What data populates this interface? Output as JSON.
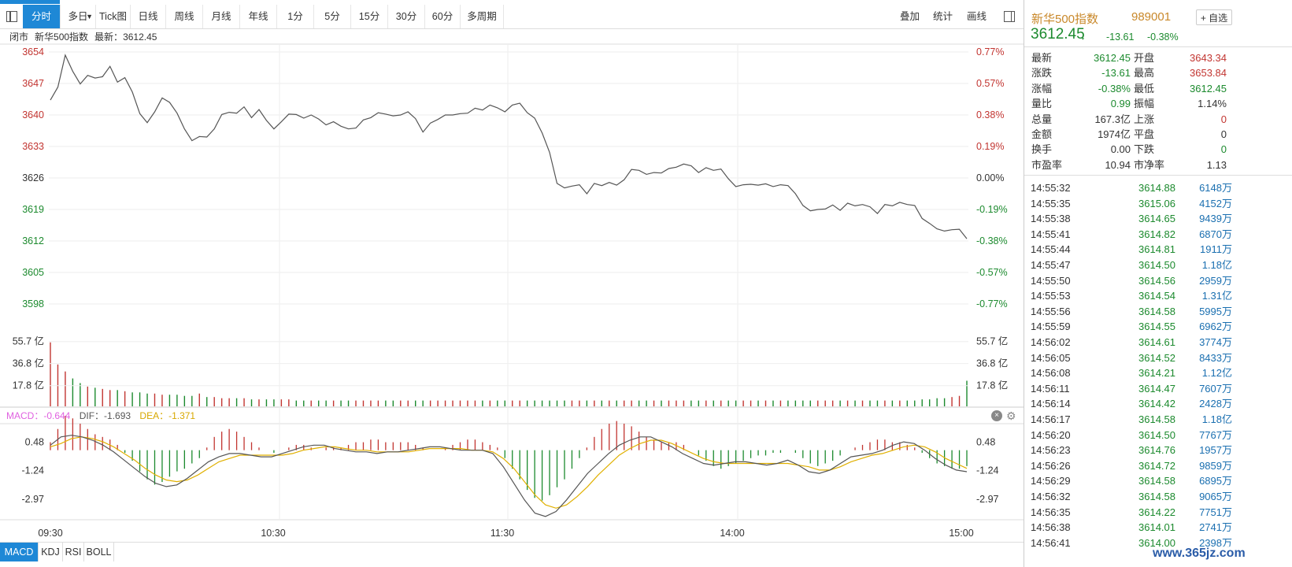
{
  "colors": {
    "accent": "#1e88d6",
    "up": "#c23531",
    "down": "#1c8a2e",
    "line": "#555555",
    "dif": "#555555",
    "dea": "#e0b000",
    "macd": "#e060e0",
    "title": "#c9882a",
    "volume_text": "#1a6fb0"
  },
  "toolbar": {
    "tabs": [
      "分时",
      "多日",
      "Tick图",
      "日线",
      "周线",
      "月线",
      "年线",
      "1分",
      "5分",
      "15分",
      "30分",
      "60分",
      "多周期"
    ],
    "active": "分时",
    "right": [
      "叠加",
      "统计",
      "画线"
    ],
    "multiday_caret": "▼"
  },
  "info": {
    "status": "闭市",
    "name": "新华500指数",
    "latest_label": "最新：",
    "latest_value": "3612.45"
  },
  "chart_data": {
    "type": "line",
    "price_axis": {
      "left_ticks": [
        "3654",
        "3647",
        "3640",
        "3633",
        "3626",
        "3619",
        "3612",
        "3605",
        "3598"
      ],
      "right_ticks": [
        "0.77%",
        "0.57%",
        "0.38%",
        "0.19%",
        "0.00%",
        "-0.19%",
        "-0.38%",
        "-0.57%",
        "-0.77%"
      ],
      "ylim": [
        3598,
        3654
      ],
      "base": 3626.06
    },
    "volume_axis": {
      "left_ticks": [
        "55.7 亿",
        "36.8 亿",
        "17.8 亿"
      ],
      "right_ticks": [
        "55.7 亿",
        "36.8 亿",
        "17.8 亿"
      ],
      "ylim": [
        0,
        65
      ]
    },
    "macd_axis": {
      "left_ticks": [
        "0.48",
        "-1.24",
        "-2.97"
      ],
      "right_ticks": [
        "0.48",
        "-1.24",
        "-2.97"
      ],
      "ylim": [
        -4.2,
        1.6
      ]
    },
    "x_ticks": [
      "09:30",
      "10:30",
      "11:30",
      "14:00",
      "15:00"
    ],
    "price_series": [
      3643.3,
      3646.2,
      3653.3,
      3649.7,
      3646.9,
      3648.8,
      3648.2,
      3648.5,
      3650.8,
      3647.3,
      3648.3,
      3645.1,
      3640.3,
      3638.3,
      3640.7,
      3643.8,
      3642.8,
      3640.4,
      3636.9,
      3634.3,
      3635.2,
      3635.1,
      3636.9,
      3640.1,
      3640.6,
      3640.4,
      3641.8,
      3639.4,
      3641.2,
      3638.8,
      3636.9,
      3638.5,
      3640.2,
      3640.1,
      3639.3,
      3640.0,
      3639.1,
      3637.8,
      3638.5,
      3637.5,
      3636.9,
      3637.1,
      3638.9,
      3639.4,
      3640.5,
      3640.2,
      3639.8,
      3640.0,
      3640.7,
      3639.2,
      3636.2,
      3638.2,
      3639.0,
      3640.0,
      3640.0,
      3640.3,
      3640.4,
      3641.5,
      3641.1,
      3642.2,
      3641.6,
      3640.7,
      3642.2,
      3642.6,
      3640.5,
      3639.3,
      3636.0,
      3631.7,
      3624.8,
      3623.8,
      3624.2,
      3624.5,
      3622.5,
      3624.8,
      3624.3,
      3625.0,
      3624.4,
      3625.6,
      3627.9,
      3627.7,
      3626.8,
      3627.2,
      3627.1,
      3628.1,
      3628.4,
      3629.1,
      3628.7,
      3627.2,
      3628.3,
      3627.7,
      3628.0,
      3625.8,
      3624.1,
      3624.5,
      3624.6,
      3624.4,
      3624.7,
      3624.1,
      3624.5,
      3624.3,
      3622.5,
      3619.9,
      3618.7,
      3619.0,
      3619.1,
      3620.0,
      3618.8,
      3620.4,
      3619.8,
      3620.1,
      3619.6,
      3618.1,
      3620.1,
      3619.8,
      3620.6,
      3620.1,
      3619.9,
      3617.0,
      3615.9,
      3614.7,
      3614.2,
      3614.5,
      3614.6,
      3612.5
    ],
    "volume_series": [
      55,
      36,
      30,
      24,
      20,
      17,
      16,
      15,
      14,
      14,
      13,
      12,
      12,
      11,
      11,
      10,
      10,
      10,
      9,
      9,
      11,
      8,
      8,
      7,
      7,
      7,
      7,
      6,
      6,
      6,
      6,
      6,
      6,
      5,
      5,
      5,
      5,
      5,
      5,
      5,
      5,
      5,
      5,
      5,
      5,
      5,
      5,
      5,
      5,
      5,
      5,
      5,
      5,
      5,
      5,
      5,
      5,
      5,
      5,
      5,
      5,
      5,
      5,
      5,
      5,
      5,
      5,
      5,
      5,
      5,
      5,
      5,
      5,
      5,
      5,
      5,
      5,
      5,
      5,
      5,
      5,
      5,
      5,
      5,
      5,
      5,
      5,
      5,
      5,
      5,
      5,
      5,
      5,
      5,
      5,
      5,
      5,
      5,
      5,
      5,
      5,
      5,
      5,
      5,
      5,
      5,
      5,
      5,
      5,
      5,
      5,
      5,
      5,
      5,
      5,
      5,
      5,
      6,
      6,
      7,
      7,
      8,
      9,
      22
    ],
    "macd_series": [
      0.3,
      0.8,
      1.3,
      1.2,
      1.0,
      0.8,
      0.6,
      0.5,
      0.4,
      0.2,
      -0.1,
      -0.4,
      -0.8,
      -1.1,
      -1.3,
      -1.2,
      -1.0,
      -0.8,
      -0.7,
      -0.5,
      -0.3,
      0.1,
      0.5,
      0.7,
      0.8,
      0.7,
      0.5,
      0.3,
      0.1,
      0.0,
      -0.1,
      0.0,
      0.1,
      0.2,
      0.2,
      0.1,
      0.0,
      0.1,
      0.1,
      0.1,
      0.2,
      0.3,
      0.3,
      0.4,
      0.4,
      0.3,
      0.3,
      0.3,
      0.3,
      0.2,
      0.1,
      0.0,
      0.0,
      0.1,
      0.2,
      0.3,
      0.4,
      0.4,
      0.3,
      0.2,
      0.1,
      -0.3,
      -0.7,
      -1.1,
      -1.5,
      -1.8,
      -1.9,
      -1.7,
      -1.4,
      -1.1,
      -0.7,
      -0.3,
      0.1,
      0.5,
      0.8,
      1.0,
      1.1,
      1.0,
      0.9,
      0.7,
      0.5,
      0.4,
      0.3,
      0.3,
      0.3,
      0.2,
      0.0,
      -0.2,
      -0.4,
      -0.6,
      -0.7,
      -0.6,
      -0.5,
      -0.4,
      -0.3,
      -0.2,
      -0.2,
      -0.1,
      -0.1,
      0.0,
      -0.1,
      -0.3,
      -0.5,
      -0.6,
      -0.5,
      -0.4,
      -0.2,
      0.0,
      0.1,
      0.2,
      0.3,
      0.4,
      0.4,
      0.3,
      0.3,
      0.2,
      0.1,
      -0.1,
      -0.3,
      -0.5,
      -0.6,
      -0.7,
      -0.7,
      -0.6
    ],
    "dif_series": [
      0.3,
      0.8,
      0.9,
      0.8,
      0.6,
      0.3,
      -0.1,
      -0.6,
      -1.1,
      -1.6,
      -2.0,
      -2.2,
      -2.1,
      -1.7,
      -1.2,
      -0.7,
      -0.4,
      -0.2,
      -0.2,
      -0.3,
      -0.4,
      -0.4,
      -0.2,
      0.0,
      0.2,
      0.3,
      0.3,
      0.1,
      0.0,
      -0.1,
      -0.1,
      -0.2,
      -0.1,
      -0.1,
      0.0,
      0.1,
      0.2,
      0.2,
      0.1,
      0.0,
      0.0,
      0.0,
      -0.2,
      -1.0,
      -2.0,
      -3.0,
      -3.8,
      -4.0,
      -3.7,
      -3.0,
      -2.2,
      -1.4,
      -0.8,
      -0.2,
      0.3,
      0.6,
      0.8,
      0.8,
      0.5,
      0.2,
      -0.2,
      -0.5,
      -0.8,
      -0.9,
      -0.8,
      -0.7,
      -0.7,
      -0.8,
      -0.9,
      -0.8,
      -0.6,
      -0.9,
      -1.3,
      -1.4,
      -1.2,
      -0.8,
      -0.4,
      -0.3,
      -0.2,
      0.0,
      0.3,
      0.5,
      0.4,
      0.0,
      -0.5,
      -0.9,
      -1.2,
      -1.3
    ],
    "dea_series": [
      0.2,
      0.4,
      0.7,
      0.8,
      0.7,
      0.5,
      0.2,
      -0.2,
      -0.6,
      -1.1,
      -1.5,
      -1.8,
      -1.9,
      -1.8,
      -1.5,
      -1.1,
      -0.7,
      -0.5,
      -0.3,
      -0.3,
      -0.3,
      -0.3,
      -0.3,
      -0.2,
      0.0,
      0.1,
      0.2,
      0.2,
      0.1,
      0.0,
      0.0,
      -0.1,
      -0.1,
      -0.1,
      -0.1,
      0.0,
      0.1,
      0.1,
      0.1,
      0.1,
      0.0,
      0.0,
      -0.1,
      -0.5,
      -1.1,
      -1.9,
      -2.7,
      -3.3,
      -3.5,
      -3.3,
      -2.8,
      -2.2,
      -1.5,
      -0.9,
      -0.3,
      0.1,
      0.4,
      0.6,
      0.6,
      0.4,
      0.1,
      -0.2,
      -0.5,
      -0.7,
      -0.8,
      -0.8,
      -0.8,
      -0.8,
      -0.8,
      -0.8,
      -0.8,
      -0.9,
      -1.0,
      -1.2,
      -1.2,
      -1.0,
      -0.7,
      -0.5,
      -0.3,
      -0.2,
      0.0,
      0.2,
      0.3,
      0.2,
      -0.1,
      -0.5,
      -0.8,
      -1.1
    ]
  },
  "macd_bar": {
    "macd": "MACD：-0.644",
    "dif": "DIF：-1.693",
    "dea": "DEA：-1.371",
    "close": "×",
    "gear": "⚙"
  },
  "bottom_tabs": [
    "MACD",
    "KDJ",
    "RSI",
    "BOLL"
  ],
  "right_panel": {
    "title": "新华500指数",
    "code": "989001",
    "add_button": "+ 自选",
    "price": "3612.45",
    "arrow": "↓",
    "change": "-13.61",
    "change_pct": "-0.38%",
    "stats_left": [
      {
        "k": "最新",
        "v": "3612.45",
        "c": "green"
      },
      {
        "k": "涨跌",
        "v": "-13.61",
        "c": "green"
      },
      {
        "k": "涨幅",
        "v": "-0.38%",
        "c": "green"
      },
      {
        "k": "量比",
        "v": "0.99",
        "c": "green"
      },
      {
        "k": "总量",
        "v": "167.3亿",
        "c": "plain"
      },
      {
        "k": "金额",
        "v": "1974亿",
        "c": "plain"
      },
      {
        "k": "换手",
        "v": "0.00",
        "c": "plain"
      },
      {
        "k": "市盈率",
        "v": "10.94",
        "c": "plain"
      }
    ],
    "stats_right": [
      {
        "k": "开盘",
        "v": "3643.34",
        "c": "red"
      },
      {
        "k": "最高",
        "v": "3653.84",
        "c": "red"
      },
      {
        "k": "最低",
        "v": "3612.45",
        "c": "green"
      },
      {
        "k": "振幅",
        "v": "1.14%",
        "c": "plain"
      },
      {
        "k": "上涨",
        "v": "0",
        "c": "red"
      },
      {
        "k": "平盘",
        "v": "0",
        "c": "plain"
      },
      {
        "k": "下跌",
        "v": "0",
        "c": "green"
      },
      {
        "k": "市净率",
        "v": "1.13",
        "c": "plain"
      }
    ],
    "ticks": [
      {
        "t": "14:55:32",
        "p": "3614.88",
        "v": "6148万"
      },
      {
        "t": "14:55:35",
        "p": "3615.06",
        "v": "4152万"
      },
      {
        "t": "14:55:38",
        "p": "3614.65",
        "v": "9439万"
      },
      {
        "t": "14:55:41",
        "p": "3614.82",
        "v": "6870万"
      },
      {
        "t": "14:55:44",
        "p": "3614.81",
        "v": "1911万"
      },
      {
        "t": "14:55:47",
        "p": "3614.50",
        "v": "1.18亿"
      },
      {
        "t": "14:55:50",
        "p": "3614.56",
        "v": "2959万"
      },
      {
        "t": "14:55:53",
        "p": "3614.54",
        "v": "1.31亿"
      },
      {
        "t": "14:55:56",
        "p": "3614.58",
        "v": "5995万"
      },
      {
        "t": "14:55:59",
        "p": "3614.55",
        "v": "6962万"
      },
      {
        "t": "14:56:02",
        "p": "3614.61",
        "v": "3774万"
      },
      {
        "t": "14:56:05",
        "p": "3614.52",
        "v": "8433万"
      },
      {
        "t": "14:56:08",
        "p": "3614.21",
        "v": "1.12亿"
      },
      {
        "t": "14:56:11",
        "p": "3614.47",
        "v": "7607万"
      },
      {
        "t": "14:56:14",
        "p": "3614.42",
        "v": "2428万"
      },
      {
        "t": "14:56:17",
        "p": "3614.58",
        "v": "1.18亿"
      },
      {
        "t": "14:56:20",
        "p": "3614.50",
        "v": "7767万"
      },
      {
        "t": "14:56:23",
        "p": "3614.76",
        "v": "1957万"
      },
      {
        "t": "14:56:26",
        "p": "3614.72",
        "v": "9859万"
      },
      {
        "t": "14:56:29",
        "p": "3614.58",
        "v": "6895万"
      },
      {
        "t": "14:56:32",
        "p": "3614.58",
        "v": "9065万"
      },
      {
        "t": "14:56:35",
        "p": "3614.22",
        "v": "7751万"
      },
      {
        "t": "14:56:38",
        "p": "3614.01",
        "v": "2741万"
      },
      {
        "t": "14:56:41",
        "p": "3614.00",
        "v": "2398万"
      }
    ]
  },
  "watermark": "www.365jz.com"
}
